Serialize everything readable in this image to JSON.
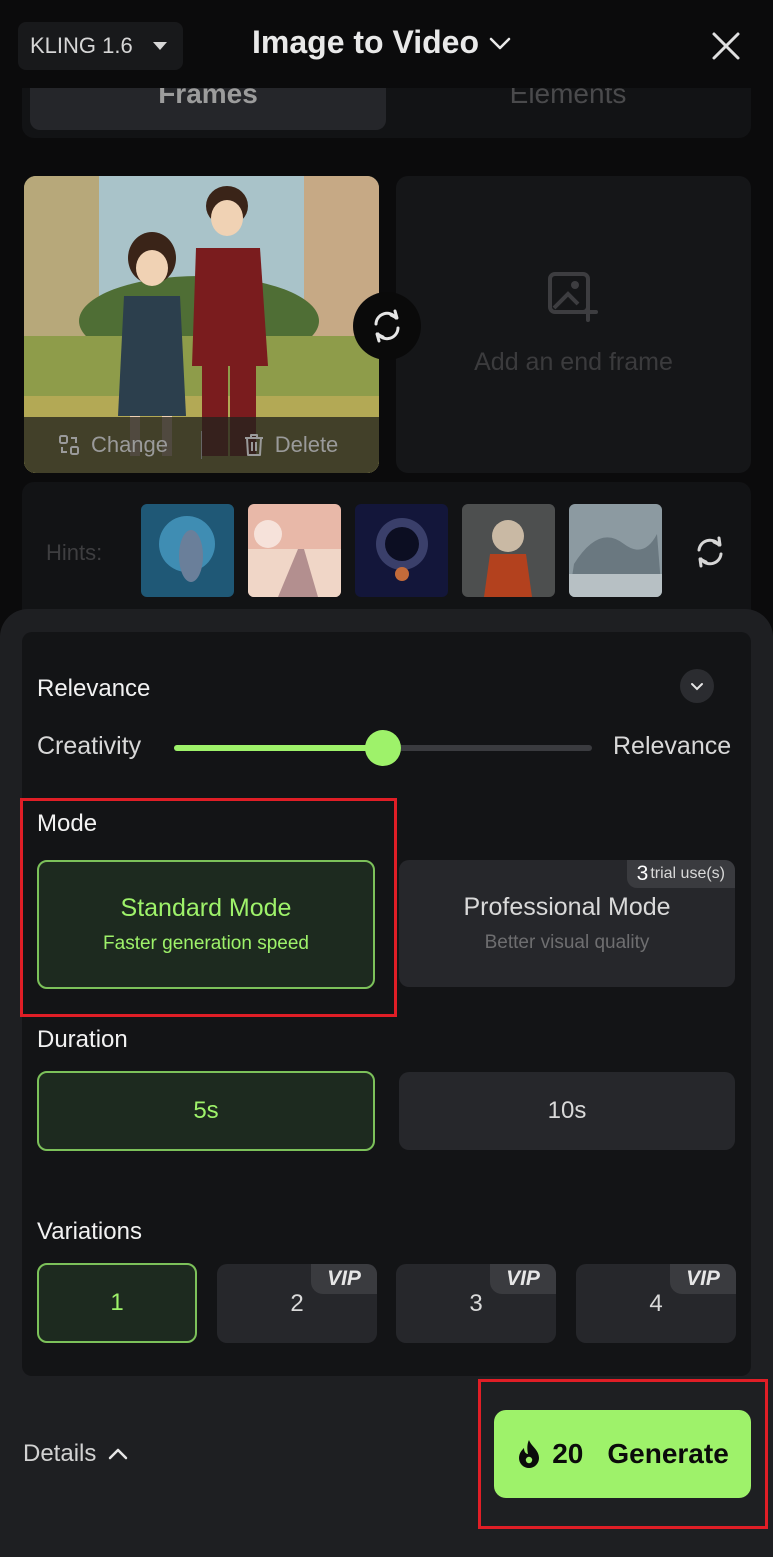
{
  "header": {
    "model": "KLING 1.6",
    "title": "Image to Video"
  },
  "tabs": [
    "Frames",
    "Elements"
  ],
  "frames": {
    "change_label": "Change",
    "delete_label": "Delete",
    "end_frame_placeholder": "Add an end frame"
  },
  "hints": {
    "label": "Hints:",
    "thumbnails": [
      "hint-underwater-girl",
      "hint-pink-road",
      "hint-astronaut",
      "hint-cat-jacket",
      "hint-dragon"
    ]
  },
  "relevance": {
    "title": "Relevance",
    "left_label": "Creativity",
    "right_label": "Relevance",
    "value": 0.5
  },
  "mode": {
    "title": "Mode",
    "standard": {
      "label": "Standard Mode",
      "sub": "Faster generation speed"
    },
    "professional": {
      "label": "Professional Mode",
      "sub": "Better visual quality",
      "trial_count": "3",
      "trial_text": "trial use(s)"
    }
  },
  "duration": {
    "title": "Duration",
    "options": [
      "5s",
      "10s"
    ],
    "selected": "5s"
  },
  "variations": {
    "title": "Variations",
    "options": [
      "1",
      "2",
      "3",
      "4"
    ],
    "vip_label": "VIP",
    "selected": "1"
  },
  "footer": {
    "details_label": "Details",
    "cost": "20",
    "generate_label": "Generate"
  },
  "colors": {
    "accent": "#9ef26a",
    "background": "#0b0b0c",
    "sheet": "#1e1f22",
    "highlight": "#e01e26"
  }
}
